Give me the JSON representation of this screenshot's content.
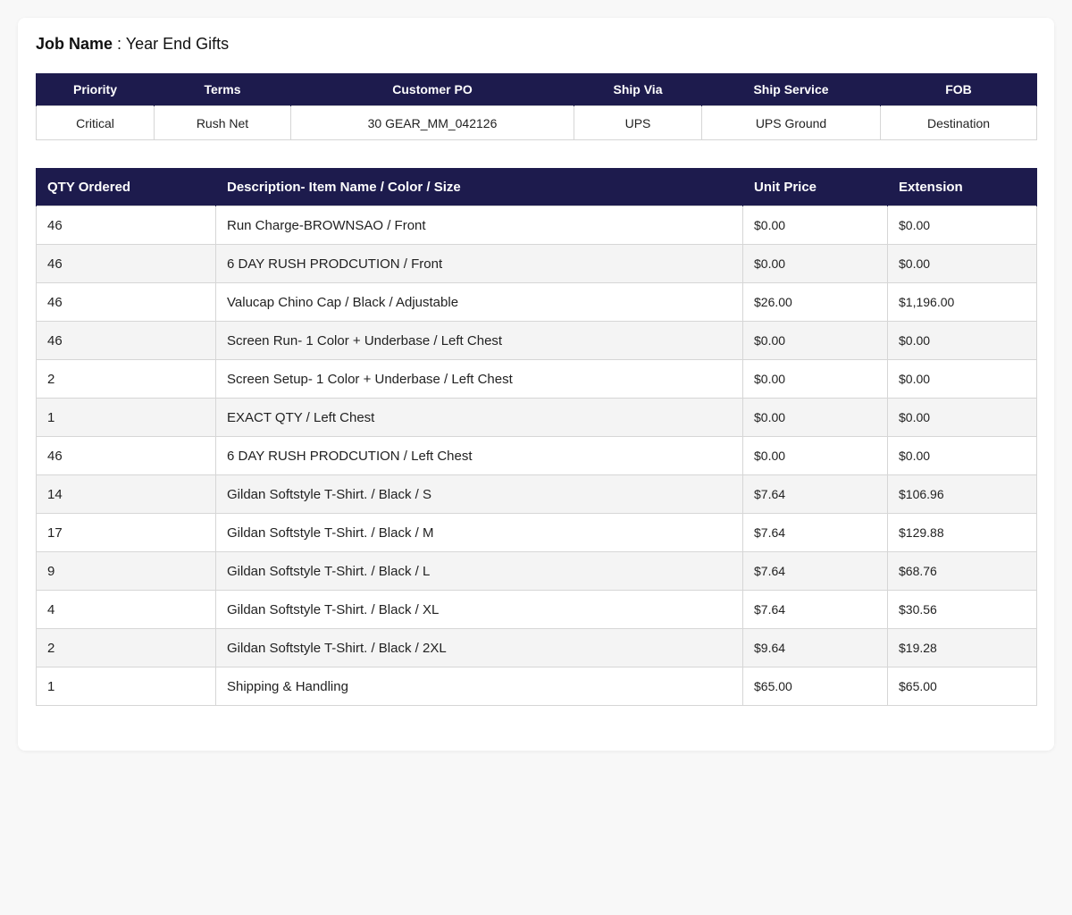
{
  "job": {
    "label": "Job Name",
    "separator": " : ",
    "value": "Year End Gifts"
  },
  "info": {
    "headers": [
      "Priority",
      "Terms",
      "Customer PO",
      "Ship Via",
      "Ship Service",
      "FOB"
    ],
    "values": [
      "Critical",
      "Rush Net",
      "30 GEAR_MM_042126",
      "UPS",
      "UPS Ground",
      "Destination"
    ]
  },
  "items": {
    "headers": [
      "QTY Ordered",
      "Description- Item Name / Color / Size",
      "Unit Price",
      "Extension"
    ],
    "rows": [
      {
        "qty": "46",
        "description": "Run Charge-BROWNSAO / Front",
        "unit_price": "$0.00",
        "extension": "$0.00"
      },
      {
        "qty": "46",
        "description": "6 DAY RUSH PRODCUTION / Front",
        "unit_price": "$0.00",
        "extension": "$0.00"
      },
      {
        "qty": "46",
        "description": "Valucap Chino Cap / Black / Adjustable",
        "unit_price": "$26.00",
        "extension": "$1,196.00"
      },
      {
        "qty": "46",
        "description": "Screen Run- 1 Color + Underbase / Left Chest",
        "unit_price": "$0.00",
        "extension": "$0.00"
      },
      {
        "qty": "2",
        "description": "Screen Setup- 1 Color + Underbase / Left Chest",
        "unit_price": "$0.00",
        "extension": "$0.00"
      },
      {
        "qty": "1",
        "description": "EXACT QTY / Left Chest",
        "unit_price": "$0.00",
        "extension": "$0.00"
      },
      {
        "qty": "46",
        "description": "6 DAY RUSH PRODCUTION / Left Chest",
        "unit_price": "$0.00",
        "extension": "$0.00"
      },
      {
        "qty": "14",
        "description": "Gildan Softstyle T-Shirt. / Black / S",
        "unit_price": "$7.64",
        "extension": "$106.96"
      },
      {
        "qty": "17",
        "description": "Gildan Softstyle T-Shirt. / Black / M",
        "unit_price": "$7.64",
        "extension": "$129.88"
      },
      {
        "qty": "9",
        "description": "Gildan Softstyle T-Shirt. / Black / L",
        "unit_price": "$7.64",
        "extension": "$68.76"
      },
      {
        "qty": "4",
        "description": "Gildan Softstyle T-Shirt. / Black / XL",
        "unit_price": "$7.64",
        "extension": "$30.56"
      },
      {
        "qty": "2",
        "description": "Gildan Softstyle T-Shirt. / Black / 2XL",
        "unit_price": "$9.64",
        "extension": "$19.28"
      },
      {
        "qty": "1",
        "description": "Shipping & Handling",
        "unit_price": "$65.00",
        "extension": "$65.00"
      }
    ]
  },
  "colors": {
    "header_bg": "#1d1b4d",
    "row_alt_bg": "#f4f4f4",
    "page_bg": "#f8f8f8"
  }
}
